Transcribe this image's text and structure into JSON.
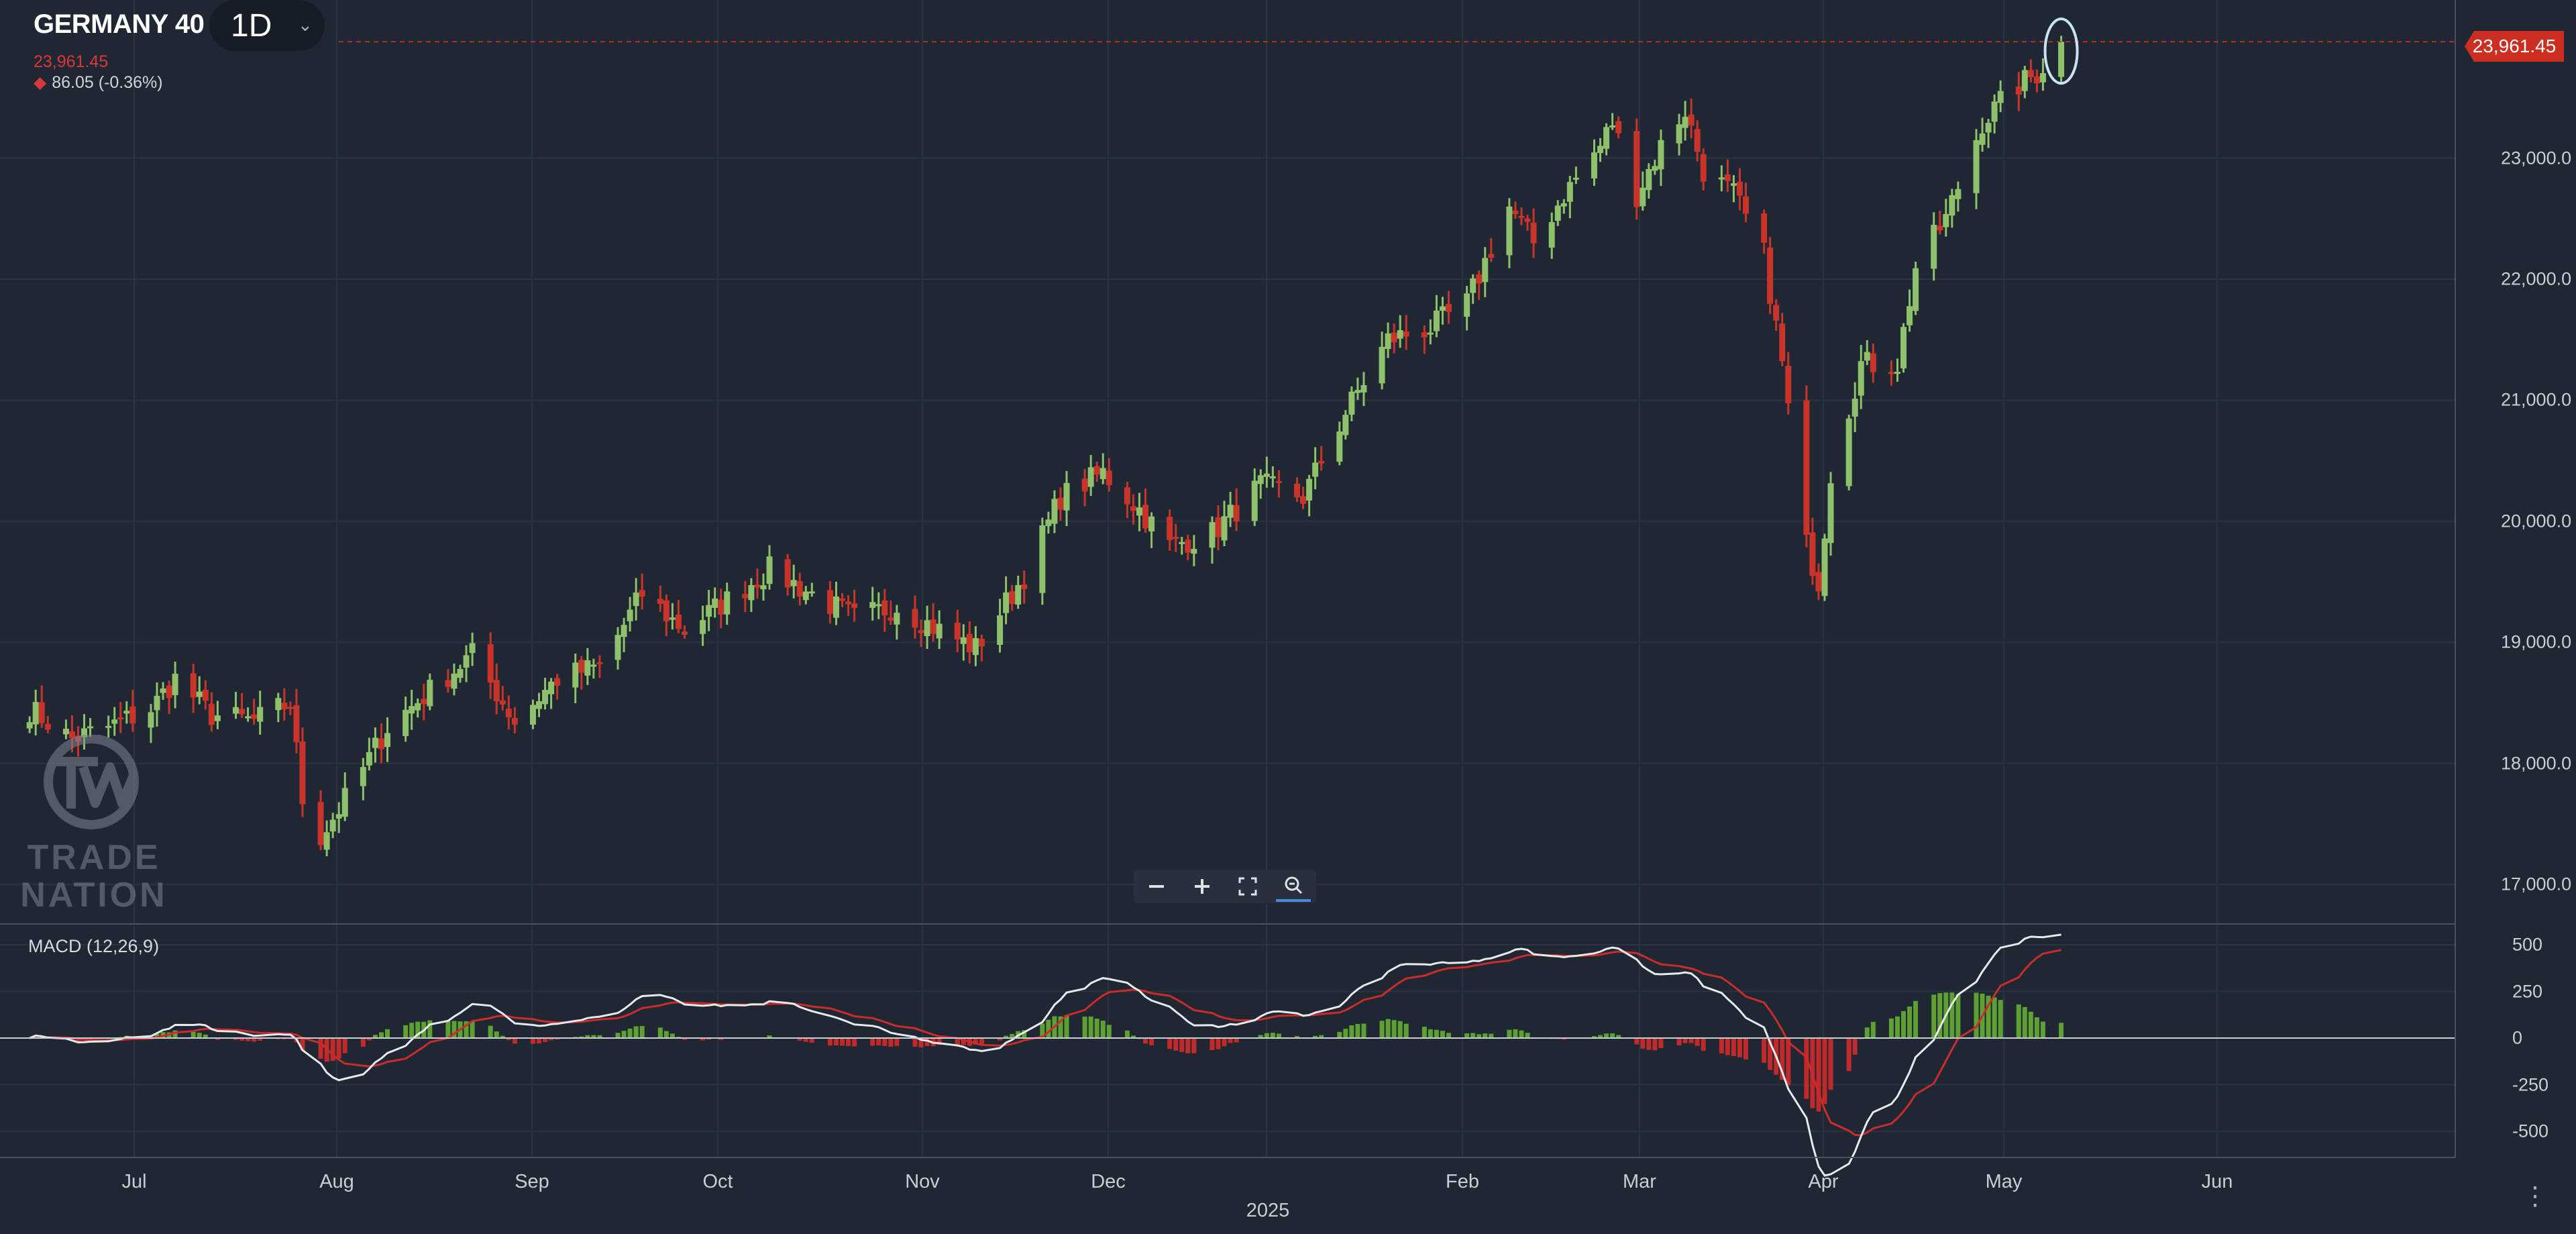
{
  "instrument": {
    "name": "GERMANY 40",
    "timeframe": "1D",
    "last_price": "23,961.45",
    "change": "86.05 (-0.36%)",
    "change_direction": "down"
  },
  "price_badge": "23,961.45",
  "price_axis": {
    "ticks": [
      "23,000.0",
      "22,000.0",
      "21,000.0",
      "20,000.0",
      "19,000.0",
      "18,000.0",
      "17,000.0"
    ],
    "tick_values": [
      23000,
      22000,
      21000,
      20000,
      19000,
      18000,
      17000
    ]
  },
  "macd": {
    "label": "MACD (12,26,9)",
    "ticks": [
      "500",
      "250",
      "0",
      "-250",
      "-500"
    ],
    "tick_values": [
      500,
      250,
      0,
      -250,
      -500
    ]
  },
  "time_axis": {
    "months": [
      "Jul",
      "Aug",
      "Sep",
      "Oct",
      "Nov",
      "Dec",
      "Feb",
      "Mar",
      "Apr",
      "May",
      "Jun"
    ],
    "year_label": "2025"
  },
  "toolbar": {
    "zoom_out_icon": "minus-icon",
    "zoom_in_icon": "plus-icon",
    "fit_icon": "fullscreen-icon",
    "reset_icon": "magnifier-reset-icon"
  },
  "logo": {
    "line1": "TRADE",
    "line2": "NATION"
  },
  "colors": {
    "background": "#1f2733",
    "up": "#8fc06b",
    "down": "#c9342a",
    "macd_line": "#e6e9ee",
    "signal_line": "#cc2b2b",
    "hist_up": "#5ea033",
    "hist_down": "#c12a2a",
    "badge": "#cc2f22"
  },
  "chart_data": {
    "type": "candlestick",
    "title": "GERMANY 40",
    "x_axis_labels": [
      "Jul",
      "Aug",
      "Sep",
      "Oct",
      "Nov",
      "Dec",
      "2025",
      "Feb",
      "Mar",
      "Apr",
      "May",
      "Jun"
    ],
    "ylim": [
      16700,
      24450
    ],
    "last_value": 23961.45,
    "close_anchors": [
      [
        "2024-06-18",
        18450
      ],
      [
        "2024-06-25",
        18200
      ],
      [
        "2024-07-01",
        18300
      ],
      [
        "2024-07-08",
        18450
      ],
      [
        "2024-07-12",
        18700
      ],
      [
        "2024-07-18",
        18400
      ],
      [
        "2024-07-25",
        18350
      ],
      [
        "2024-07-31",
        18500
      ],
      [
        "2024-08-02",
        17700
      ],
      [
        "2024-08-05",
        17400
      ],
      [
        "2024-08-09",
        17700
      ],
      [
        "2024-08-16",
        18300
      ],
      [
        "2024-08-23",
        18600
      ],
      [
        "2024-08-30",
        18900
      ],
      [
        "2024-09-06",
        18350
      ],
      [
        "2024-09-13",
        18700
      ],
      [
        "2024-09-20",
        18800
      ],
      [
        "2024-09-27",
        19400
      ],
      [
        "2024-10-04",
        19100
      ],
      [
        "2024-10-11",
        19350
      ],
      [
        "2024-10-18",
        19600
      ],
      [
        "2024-10-25",
        19400
      ],
      [
        "2024-11-01",
        19200
      ],
      [
        "2024-11-08",
        19300
      ],
      [
        "2024-11-15",
        19100
      ],
      [
        "2024-11-21",
        18950
      ],
      [
        "2024-11-29",
        19550
      ],
      [
        "2024-12-05",
        20200
      ],
      [
        "2024-12-12",
        20400
      ],
      [
        "2024-12-18",
        20100
      ],
      [
        "2024-12-23",
        19800
      ],
      [
        "2024-12-30",
        19900
      ],
      [
        "2025-01-07",
        20300
      ],
      [
        "2025-01-14",
        20200
      ],
      [
        "2025-01-21",
        20900
      ],
      [
        "2025-01-28",
        21500
      ],
      [
        "2025-02-04",
        21600
      ],
      [
        "2025-02-10",
        21800
      ],
      [
        "2025-02-17",
        22600
      ],
      [
        "2025-02-21",
        22300
      ],
      [
        "2025-02-26",
        22700
      ],
      [
        "2025-03-04",
        23100
      ],
      [
        "2025-03-06",
        23300
      ],
      [
        "2025-03-10",
        22700
      ],
      [
        "2025-03-14",
        23100
      ],
      [
        "2025-03-18",
        23400
      ],
      [
        "2025-03-21",
        22900
      ],
      [
        "2025-03-26",
        22700
      ],
      [
        "2025-03-31",
        22200
      ],
      [
        "2025-04-03",
        21300
      ],
      [
        "2025-04-07",
        19800
      ],
      [
        "2025-04-09",
        19500
      ],
      [
        "2025-04-11",
        20400
      ],
      [
        "2025-04-16",
        21300
      ],
      [
        "2025-04-22",
        21300
      ],
      [
        "2025-04-25",
        22100
      ],
      [
        "2025-04-30",
        22500
      ],
      [
        "2025-05-06",
        23300
      ],
      [
        "2025-05-12",
        23600
      ],
      [
        "2025-05-15",
        23700
      ],
      [
        "2025-05-19",
        23961.45
      ]
    ]
  }
}
